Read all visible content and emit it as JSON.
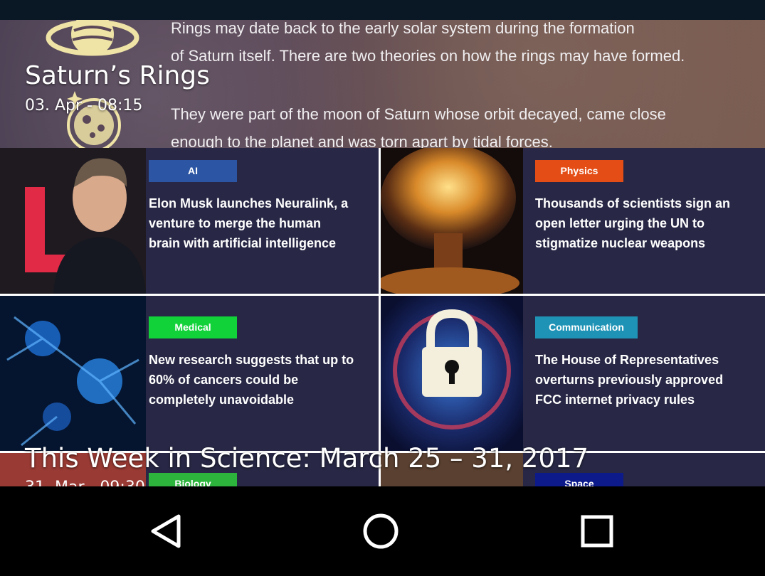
{
  "articles": [
    {
      "title": "Saturn’s Rings",
      "date": "03. Apr - 08:15",
      "image_text": [
        "Rings may date back to the early solar system during the formation",
        "of Saturn itself. There are two theories on how the rings may have formed.",
        "They were part of the moon of Saturn whose orbit decayed, came close",
        "enough to the planet and was torn apart by tidal forces."
      ]
    },
    {
      "title": "This Week in Science: March 25 – 31, 2017",
      "date": "31. Mar - 09:30",
      "tiles": [
        {
          "category": "AI",
          "color": "#2c55a3",
          "headline": [
            "Elon Musk launches Neuralink, a",
            "venture to merge the human",
            "brain with artificial intelligence"
          ]
        },
        {
          "category": "Physics",
          "color": "#e44d15",
          "headline": [
            "Thousands of scientists sign an",
            "open letter urging the UN to",
            "stigmatize nuclear weapons"
          ]
        },
        {
          "category": "Medical",
          "color": "#12d23a",
          "headline": [
            "New research suggests that up to",
            "60% of cancers could be",
            "completely unavoidable"
          ]
        },
        {
          "category": "Communication",
          "color": "#1f93b6",
          "headline": [
            "The House of Representatives",
            "overturns previously approved",
            "FCC internet privacy rules"
          ]
        },
        {
          "category": "Biology",
          "color": "#2cb43c",
          "headline": []
        },
        {
          "category": "Space",
          "color": "#0c1a8a",
          "headline": []
        }
      ]
    }
  ],
  "navigation": {
    "back_icon": "triangle-back-icon",
    "home_icon": "circle-home-icon",
    "recents_icon": "square-recents-icon"
  }
}
